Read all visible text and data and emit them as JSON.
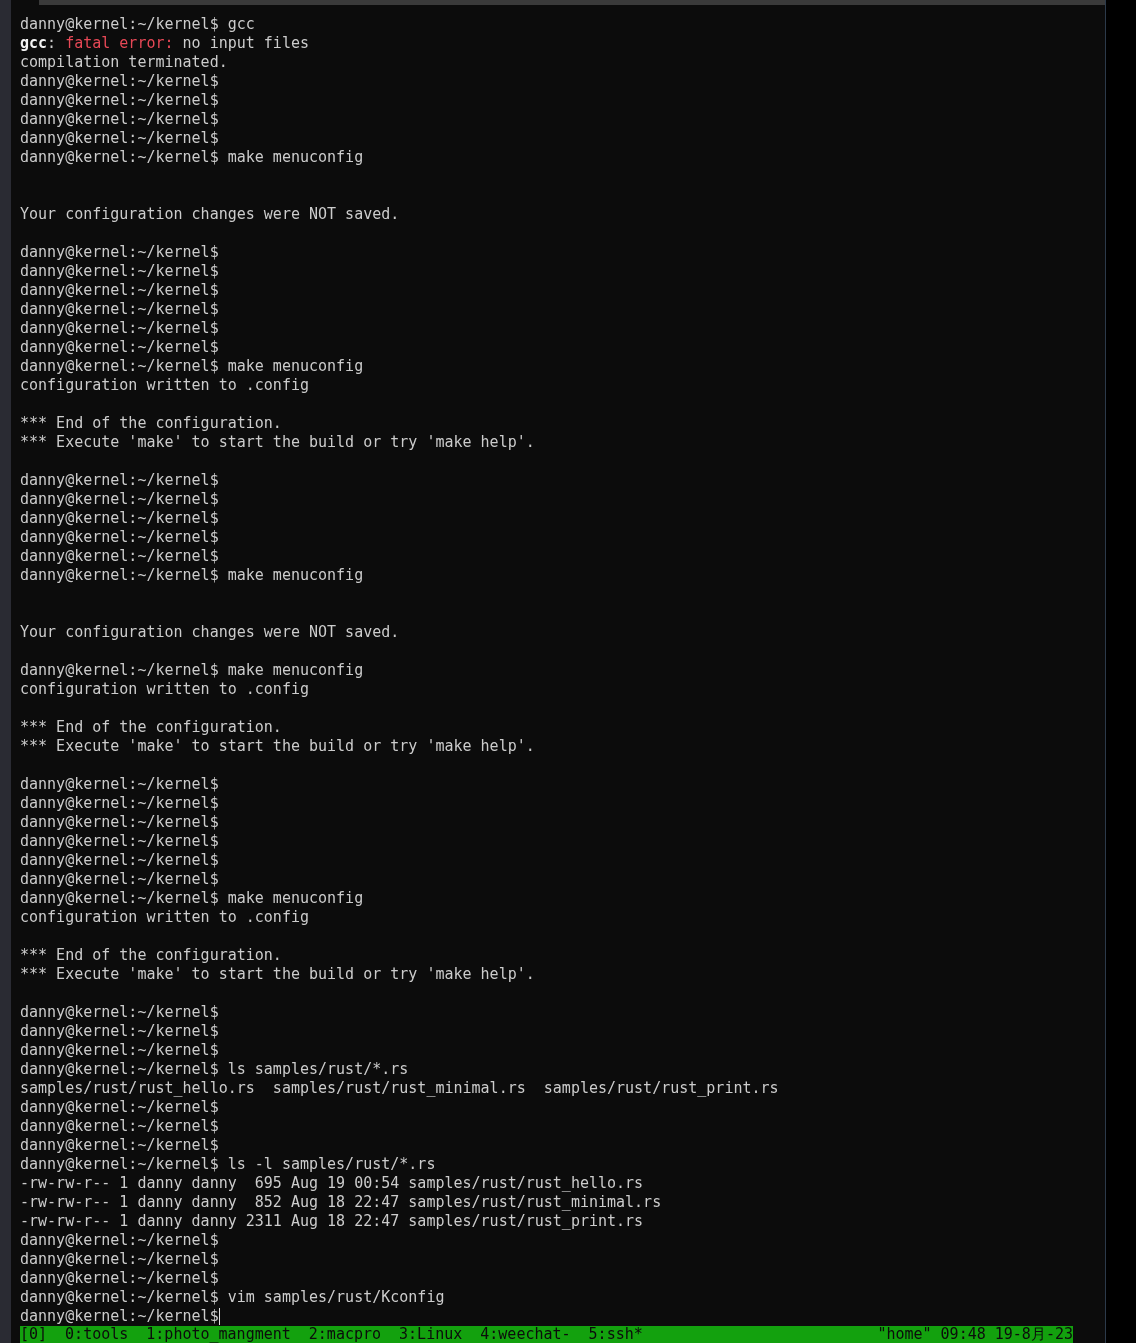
{
  "terminal": {
    "lines": [
      {
        "kind": "text",
        "text": "danny@kernel:~/kernel$ gcc"
      },
      {
        "kind": "error",
        "parts": [
          {
            "text": "gcc",
            "kind": "bold"
          },
          {
            "text": ": ",
            "kind": "plain"
          },
          {
            "text": "fatal error:",
            "kind": "error"
          },
          {
            "text": " no input files",
            "kind": "plain"
          }
        ]
      },
      {
        "kind": "text",
        "text": "compilation terminated."
      },
      {
        "kind": "text",
        "text": "danny@kernel:~/kernel$"
      },
      {
        "kind": "text",
        "text": "danny@kernel:~/kernel$"
      },
      {
        "kind": "text",
        "text": "danny@kernel:~/kernel$"
      },
      {
        "kind": "text",
        "text": "danny@kernel:~/kernel$"
      },
      {
        "kind": "text",
        "text": "danny@kernel:~/kernel$ make menuconfig"
      },
      {
        "kind": "blank"
      },
      {
        "kind": "blank"
      },
      {
        "kind": "text",
        "text": "Your configuration changes were NOT saved."
      },
      {
        "kind": "blank"
      },
      {
        "kind": "text",
        "text": "danny@kernel:~/kernel$"
      },
      {
        "kind": "text",
        "text": "danny@kernel:~/kernel$"
      },
      {
        "kind": "text",
        "text": "danny@kernel:~/kernel$"
      },
      {
        "kind": "text",
        "text": "danny@kernel:~/kernel$"
      },
      {
        "kind": "text",
        "text": "danny@kernel:~/kernel$"
      },
      {
        "kind": "text",
        "text": "danny@kernel:~/kernel$"
      },
      {
        "kind": "text",
        "text": "danny@kernel:~/kernel$ make menuconfig"
      },
      {
        "kind": "text",
        "text": "configuration written to .config"
      },
      {
        "kind": "blank"
      },
      {
        "kind": "text",
        "text": "*** End of the configuration."
      },
      {
        "kind": "text",
        "text": "*** Execute 'make' to start the build or try 'make help'."
      },
      {
        "kind": "blank"
      },
      {
        "kind": "text",
        "text": "danny@kernel:~/kernel$"
      },
      {
        "kind": "text",
        "text": "danny@kernel:~/kernel$"
      },
      {
        "kind": "text",
        "text": "danny@kernel:~/kernel$"
      },
      {
        "kind": "text",
        "text": "danny@kernel:~/kernel$"
      },
      {
        "kind": "text",
        "text": "danny@kernel:~/kernel$"
      },
      {
        "kind": "text",
        "text": "danny@kernel:~/kernel$ make menuconfig"
      },
      {
        "kind": "blank"
      },
      {
        "kind": "blank"
      },
      {
        "kind": "text",
        "text": "Your configuration changes were NOT saved."
      },
      {
        "kind": "blank"
      },
      {
        "kind": "text",
        "text": "danny@kernel:~/kernel$ make menuconfig"
      },
      {
        "kind": "text",
        "text": "configuration written to .config"
      },
      {
        "kind": "blank"
      },
      {
        "kind": "text",
        "text": "*** End of the configuration."
      },
      {
        "kind": "text",
        "text": "*** Execute 'make' to start the build or try 'make help'."
      },
      {
        "kind": "blank"
      },
      {
        "kind": "text",
        "text": "danny@kernel:~/kernel$"
      },
      {
        "kind": "text",
        "text": "danny@kernel:~/kernel$"
      },
      {
        "kind": "text",
        "text": "danny@kernel:~/kernel$"
      },
      {
        "kind": "text",
        "text": "danny@kernel:~/kernel$"
      },
      {
        "kind": "text",
        "text": "danny@kernel:~/kernel$"
      },
      {
        "kind": "text",
        "text": "danny@kernel:~/kernel$"
      },
      {
        "kind": "text",
        "text": "danny@kernel:~/kernel$ make menuconfig"
      },
      {
        "kind": "text",
        "text": "configuration written to .config"
      },
      {
        "kind": "blank"
      },
      {
        "kind": "text",
        "text": "*** End of the configuration."
      },
      {
        "kind": "text",
        "text": "*** Execute 'make' to start the build or try 'make help'."
      },
      {
        "kind": "blank"
      },
      {
        "kind": "text",
        "text": "danny@kernel:~/kernel$"
      },
      {
        "kind": "text",
        "text": "danny@kernel:~/kernel$"
      },
      {
        "kind": "text",
        "text": "danny@kernel:~/kernel$"
      },
      {
        "kind": "text",
        "text": "danny@kernel:~/kernel$ ls samples/rust/*.rs"
      },
      {
        "kind": "text",
        "text": "samples/rust/rust_hello.rs  samples/rust/rust_minimal.rs  samples/rust/rust_print.rs"
      },
      {
        "kind": "text",
        "text": "danny@kernel:~/kernel$"
      },
      {
        "kind": "text",
        "text": "danny@kernel:~/kernel$"
      },
      {
        "kind": "text",
        "text": "danny@kernel:~/kernel$"
      },
      {
        "kind": "text",
        "text": "danny@kernel:~/kernel$ ls -l samples/rust/*.rs"
      },
      {
        "kind": "text",
        "text": "-rw-rw-r-- 1 danny danny  695 Aug 19 00:54 samples/rust/rust_hello.rs"
      },
      {
        "kind": "text",
        "text": "-rw-rw-r-- 1 danny danny  852 Aug 18 22:47 samples/rust/rust_minimal.rs"
      },
      {
        "kind": "text",
        "text": "-rw-rw-r-- 1 danny danny 2311 Aug 18 22:47 samples/rust/rust_print.rs"
      },
      {
        "kind": "text",
        "text": "danny@kernel:~/kernel$"
      },
      {
        "kind": "text",
        "text": "danny@kernel:~/kernel$"
      },
      {
        "kind": "text",
        "text": "danny@kernel:~/kernel$"
      },
      {
        "kind": "text",
        "text": "danny@kernel:~/kernel$ vim samples/rust/Kconfig"
      },
      {
        "kind": "cursor",
        "text": "danny@kernel:~/kernel$"
      }
    ]
  },
  "status_bar": {
    "session": "[0]",
    "windows": [
      "0:tools",
      "1:photo_mangment",
      "2:macpro",
      "3:Linux",
      "4:weechat-",
      "5:ssh*"
    ],
    "right": "\"home\" 09:48 19-8月-23"
  }
}
